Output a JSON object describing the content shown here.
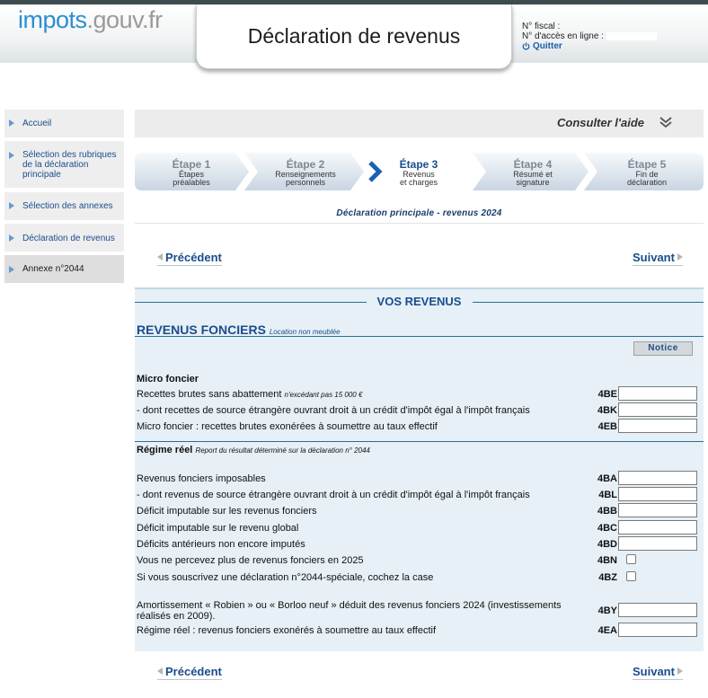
{
  "logo": {
    "part1": "impots",
    "part2": ".gouv.fr"
  },
  "header": {
    "title": "Déclaration de revenus",
    "fiscal_label": "N° fiscal :",
    "access_label": "N° d'accès en ligne :",
    "quit": "Quitter"
  },
  "sidebar": {
    "items": [
      {
        "label": "Accueil"
      },
      {
        "label": "Sélection des rubriques de la déclaration principale"
      },
      {
        "label": "Sélection des annexes"
      },
      {
        "label": "Déclaration de revenus"
      },
      {
        "label": "Annexe n°2044"
      }
    ]
  },
  "help": {
    "label": "Consulter l'aide"
  },
  "steps": [
    {
      "num": "Étape 1",
      "desc1": "Étapes",
      "desc2": "préalables"
    },
    {
      "num": "Étape 2",
      "desc1": "Renseignements",
      "desc2": "personnels"
    },
    {
      "num": "Étape 3",
      "desc1": "Revenus",
      "desc2": "et charges"
    },
    {
      "num": "Étape 4",
      "desc1": "Résumé et",
      "desc2": "signature"
    },
    {
      "num": "Étape 5",
      "desc1": "Fin de",
      "desc2": "déclaration"
    }
  ],
  "subtitle": "Déclaration principale - revenus 2024",
  "nav": {
    "prev": "Précédent",
    "next": "Suivant"
  },
  "form": {
    "banner": "VOS REVENUS",
    "section": "REVENUS FONCIERS",
    "section_sub": "Location non meublée",
    "notice": "Notice",
    "micro_title": "Micro foncier",
    "micro_rows": [
      {
        "label": "Recettes brutes sans abattement",
        "note": "n'excédant pas 15 000 €",
        "code": "4BE"
      },
      {
        "label": "- dont recettes de source étrangère ouvrant droit à un crédit d'impôt égal à l'impôt français",
        "note": "",
        "code": "4BK"
      },
      {
        "label": "Micro foncier : recettes brutes exonérées à soumettre au taux effectif",
        "note": "",
        "code": "4EB"
      }
    ],
    "reel_title": "Régime réel",
    "reel_note": "Report du résultat déterminé sur la déclaration n° 2044",
    "reel_rows": [
      {
        "label": "Revenus fonciers imposables",
        "code": "4BA"
      },
      {
        "label": "- dont revenus de source étrangère ouvrant droit à un crédit d'impôt égal à l'impôt français",
        "code": "4BL"
      },
      {
        "label": "Déficit imputable sur les revenus fonciers",
        "code": "4BB"
      },
      {
        "label": "Déficit imputable sur le revenu global",
        "code": "4BC"
      },
      {
        "label": "Déficits antérieurs non encore imputés",
        "code": "4BD"
      }
    ],
    "check_rows": [
      {
        "label": "Vous ne percevez plus de revenus fonciers en 2025",
        "code": "4BN"
      },
      {
        "label": "Si vous souscrivez une déclaration n°2044-spéciale, cochez la case",
        "code": "4BZ"
      }
    ],
    "last_rows": [
      {
        "label": "Amortissement « Robien » ou « Borloo neuf » déduit des revenus fonciers 2024 (investissements réalisés en 2009).",
        "code": "4BY"
      },
      {
        "label": "Régime réel : revenus fonciers exonérés à soumettre au taux effectif",
        "code": "4EA"
      }
    ]
  }
}
